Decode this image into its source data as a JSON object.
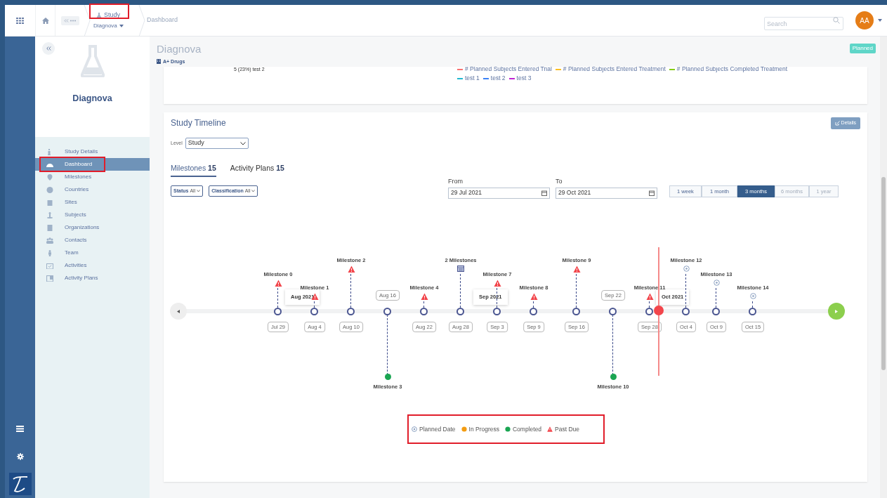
{
  "topbar": {
    "breadcrumb": {
      "section": "Study",
      "study": "Diagnova",
      "page": "Dashboard"
    },
    "search": {
      "placeholder": "Search"
    },
    "avatar": "AA"
  },
  "sidebar": {
    "study_name": "Diagnova",
    "items": [
      {
        "label": "Study Details",
        "selected": false
      },
      {
        "label": "Dashboard",
        "selected": true
      },
      {
        "label": "Milestones",
        "selected": false
      },
      {
        "label": "Countries",
        "selected": false
      },
      {
        "label": "Sites",
        "selected": false
      },
      {
        "label": "Subjects",
        "selected": false
      },
      {
        "label": "Organizations",
        "selected": false
      },
      {
        "label": "Contacts",
        "selected": false
      },
      {
        "label": "Team",
        "selected": false
      },
      {
        "label": "Activities",
        "selected": false
      },
      {
        "label": "Activity Plans",
        "selected": false
      }
    ]
  },
  "header": {
    "title": "Diagnova",
    "organization": "A+ Drugs",
    "status_badge": "Planned"
  },
  "chart_card": {
    "pie_label": "5 (23%) test 2",
    "legend": [
      {
        "label": "# Planned Subjects Entered Trial",
        "color": "#f87171"
      },
      {
        "label": "# Planned Subjects Entered Treatment",
        "color": "#fbbf24"
      },
      {
        "label": "# Planned Subjects Completed Treatment",
        "color": "#84cc16"
      },
      {
        "label": "test 1",
        "color": "#22b8cf"
      },
      {
        "label": "test 2",
        "color": "#3b82f6"
      },
      {
        "label": "test 3",
        "color": "#c026d3"
      }
    ]
  },
  "timeline_card": {
    "title": "Study Timeline",
    "details_button": "Details",
    "level": {
      "label": "Level",
      "value": "Study"
    },
    "tabs": [
      {
        "label": "Milestones",
        "count": "15",
        "selected": true
      },
      {
        "label": "Activity Plans",
        "count": "15",
        "selected": false
      }
    ],
    "filters": [
      {
        "label": "Status",
        "value": "All"
      },
      {
        "label": "Classification",
        "value": "All"
      }
    ],
    "from": {
      "label": "From",
      "value": "29 Jul 2021"
    },
    "to": {
      "label": "To",
      "value": "29 Oct 2021"
    },
    "ranges": [
      {
        "label": "1 week",
        "selected": false,
        "disabled": false
      },
      {
        "label": "1 month",
        "selected": false,
        "disabled": false
      },
      {
        "label": "3 months",
        "selected": true,
        "disabled": false
      },
      {
        "label": "6 months",
        "selected": false,
        "disabled": true
      },
      {
        "label": "1 year",
        "selected": false,
        "disabled": true
      }
    ],
    "months": [
      "Aug 2021",
      "Sep 2021",
      "Oct 2021"
    ],
    "milestones": [
      {
        "label": "Milestone 0",
        "date": "Jul 29",
        "kind": "past_due"
      },
      {
        "label": "Milestone 1",
        "date": "Aug 4",
        "kind": "past_due"
      },
      {
        "label": "Milestone 2",
        "date": "Aug 10",
        "kind": "past_due"
      },
      {
        "label": "Milestone 3",
        "date": "Aug 16",
        "kind": "completed"
      },
      {
        "label": "Milestone 4",
        "date": "Aug 22",
        "kind": "past_due"
      },
      {
        "label": "2 Milestones",
        "date": "Aug 28",
        "kind": "group"
      },
      {
        "label": "Milestone 7",
        "date": "Sep 3",
        "kind": "past_due"
      },
      {
        "label": "Milestone 8",
        "date": "Sep 9",
        "kind": "past_due"
      },
      {
        "label": "Milestone 9",
        "date": "Sep 16",
        "kind": "past_due"
      },
      {
        "label": "Milestone 10",
        "date": "Sep 22",
        "kind": "completed"
      },
      {
        "label": "Milestone 11",
        "date": "Sep 28",
        "kind": "past_due"
      },
      {
        "label": "Milestone 12",
        "date": "Oct 4",
        "kind": "planned"
      },
      {
        "label": "Milestone 13",
        "date": "Oct 9",
        "kind": "planned"
      },
      {
        "label": "Milestone 14",
        "date": "Oct 15",
        "kind": "planned"
      }
    ],
    "legend": [
      {
        "label": "Planned Date",
        "kind": "planned"
      },
      {
        "label": "In Progress",
        "kind": "in_progress"
      },
      {
        "label": "Completed",
        "kind": "completed"
      },
      {
        "label": "Past Due",
        "kind": "past_due"
      }
    ]
  }
}
